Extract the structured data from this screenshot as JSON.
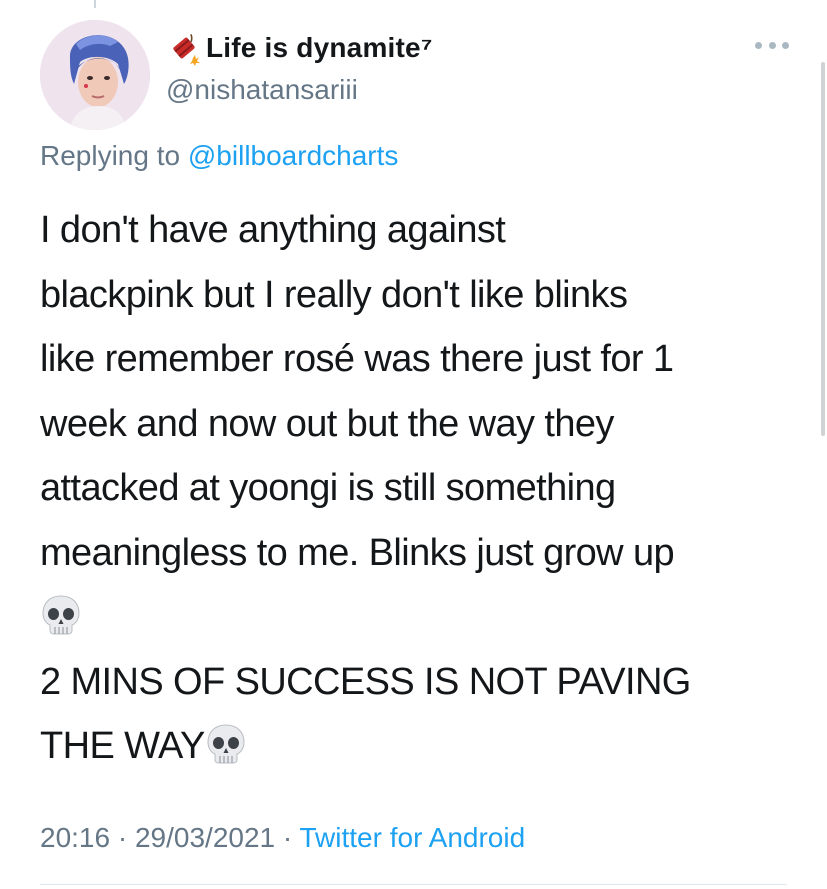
{
  "tweet": {
    "author": {
      "display_name": "Life is dynamite⁷",
      "handle": "@nishatansariii",
      "avatar_icon": "profile-photo",
      "name_icon": "dynamite-icon"
    },
    "more_icon": "ellipsis-icon",
    "replying": {
      "prefix": "Replying to",
      "mention": "@billboardcharts"
    },
    "body_lines": [
      "I don't have anything against",
      "blackpink but I really don't like blinks",
      "like remember rosé was there just for 1",
      "week and now out but the way they",
      "attacked at yoongi is still something",
      "meaningless to me. Blinks just grow up",
      "",
      "2 MINS OF SUCCESS IS NOT PAVING",
      "THE WAY"
    ],
    "emoji": "skull-icon",
    "meta": {
      "time": "20:16",
      "sep1": " · ",
      "date": "29/03/2021",
      "sep2": " · ",
      "source": "Twitter for Android"
    }
  },
  "colors": {
    "text": "#14171a",
    "secondary": "#657786",
    "link": "#1da1f2",
    "divider": "#e1e8ed"
  }
}
